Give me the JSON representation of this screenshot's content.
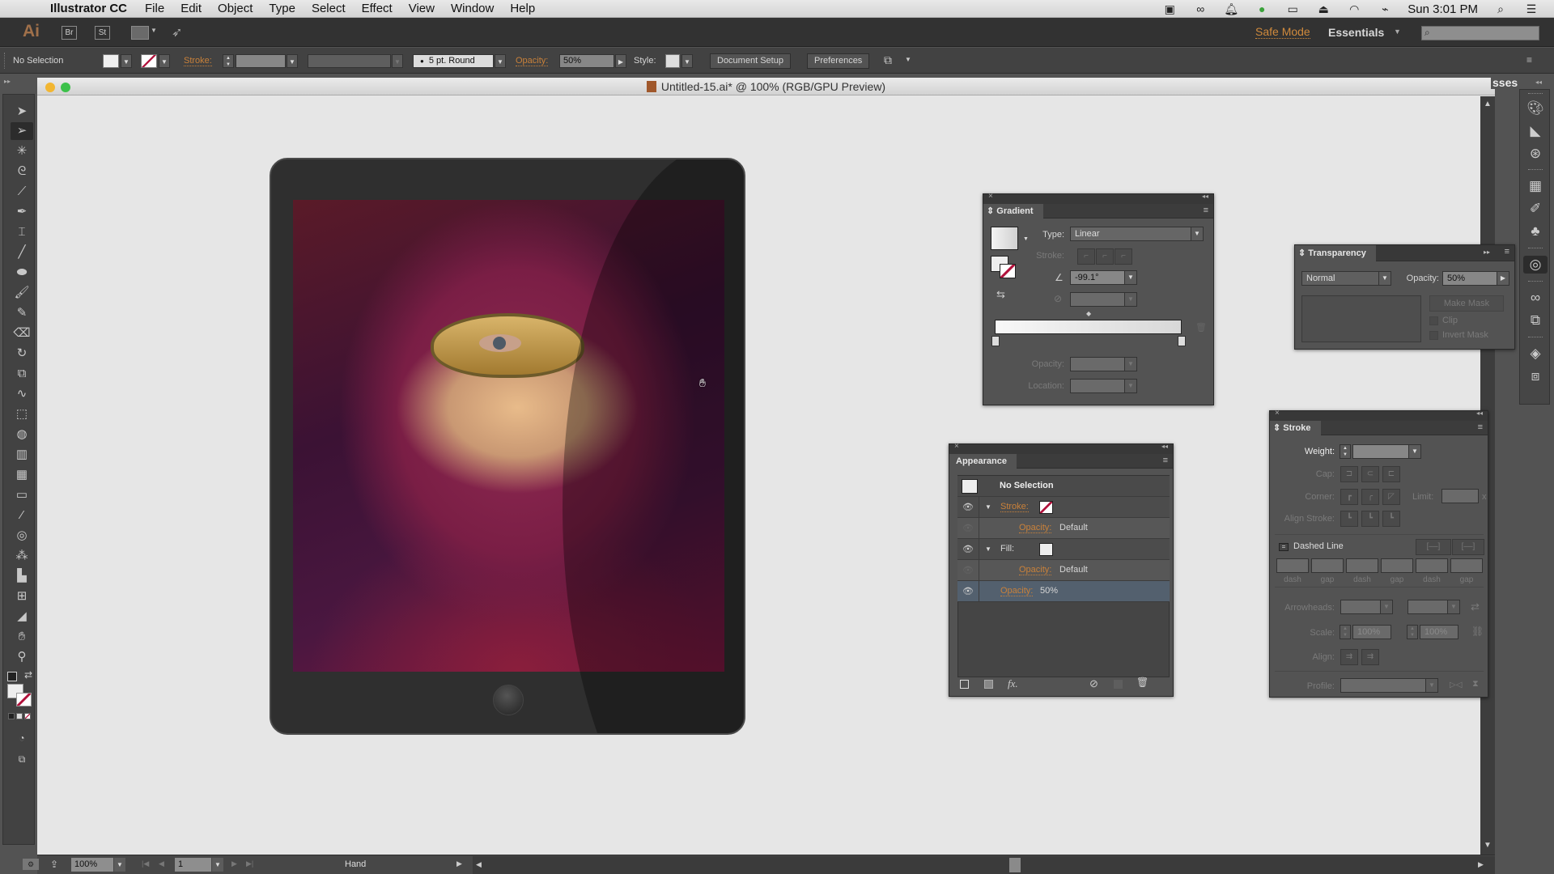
{
  "menubar": {
    "app_name": "Illustrator CC",
    "menus": [
      "File",
      "Edit",
      "Object",
      "Type",
      "Select",
      "Effect",
      "View",
      "Window",
      "Help"
    ],
    "clock": "Sun 3:01 PM",
    "status_icons": [
      "camera-icon",
      "creative-cloud-icon",
      "notification-bell-icon",
      "green-sync-icon",
      "display-icon",
      "airplay-icon",
      "wifi-icon",
      "battery-icon",
      "spotlight-search-icon",
      "notification-center-icon"
    ]
  },
  "appbar": {
    "logo": "Ai",
    "bridge_label": "Br",
    "stock_label": "St",
    "safe_mode": "Safe Mode",
    "workspace": "Essentials",
    "search_placeholder": ""
  },
  "control_bar": {
    "selection_status": "No Selection",
    "stroke_label": "Stroke:",
    "stroke_weight": "",
    "brush": "5 pt. Round",
    "opacity_label": "Opacity:",
    "opacity_value": "50%",
    "style_label": "Style:",
    "document_setup": "Document Setup",
    "preferences": "Preferences"
  },
  "document": {
    "title": "Untitled-15.ai* @ 100% (RGB/GPU Preview)",
    "background_panel_fragment": "sses",
    "artwork_description": "Tablet mockup with hooded woman wearing a gold masquerade mask"
  },
  "status_bar": {
    "zoom": "100%",
    "artboard": "1",
    "tool": "Hand"
  },
  "gradient_panel": {
    "title": "Gradient",
    "type_label": "Type:",
    "type_value": "Linear",
    "stroke_label": "Stroke:",
    "angle_value": "-99.1°",
    "aspect_value": "",
    "opacity_label": "Opacity:",
    "opacity_value": "",
    "location_label": "Location:",
    "location_value": ""
  },
  "transparency_panel": {
    "title": "Transparency",
    "blend_mode": "Normal",
    "opacity_label": "Opacity:",
    "opacity_value": "50%",
    "make_mask": "Make Mask",
    "clip": "Clip",
    "invert_mask": "Invert Mask"
  },
  "appearance_panel": {
    "title": "Appearance",
    "header": "No Selection",
    "rows": [
      {
        "label": "Stroke:",
        "value": ""
      },
      {
        "label": "Opacity:",
        "value": "Default"
      },
      {
        "label": "Fill:",
        "value": ""
      },
      {
        "label": "Opacity:",
        "value": "Default"
      },
      {
        "label": "Opacity:",
        "value": "50%"
      }
    ],
    "footer_fx": "fx."
  },
  "stroke_panel": {
    "title": "Stroke",
    "weight_label": "Weight:",
    "weight_value": "",
    "cap_label": "Cap:",
    "corner_label": "Corner:",
    "limit_label": "Limit:",
    "limit_value": "",
    "limit_suffix": "x",
    "align_stroke_label": "Align Stroke:",
    "dashed_line_label": "Dashed Line",
    "dash_labels": [
      "dash",
      "gap",
      "dash",
      "gap",
      "dash",
      "gap"
    ],
    "arrowheads_label": "Arrowheads:",
    "scale_label": "Scale:",
    "scale_start": "100%",
    "scale_end": "100%",
    "align_label": "Align:",
    "profile_label": "Profile:"
  },
  "colors": {
    "accent_orange": "#c9813a",
    "panel_bg": "#535353",
    "selected_row": "#53606e",
    "none_red": "#b0103a"
  }
}
